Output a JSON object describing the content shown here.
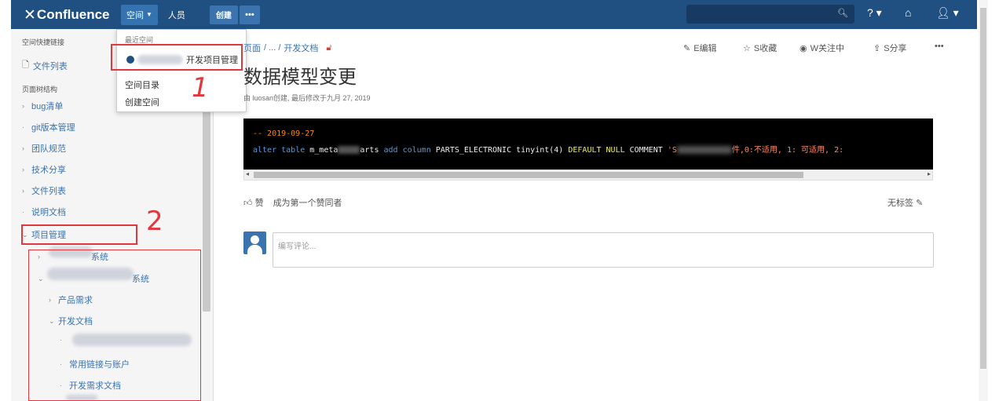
{
  "topnav": {
    "logo": "Confluence",
    "spaces": "空间",
    "people": "人员",
    "create": "创建",
    "more": "•••"
  },
  "sidebar": {
    "shortcuts_heading": "空间快捷链接",
    "file_list_link": "文件列表",
    "tree_heading": "页面树结构",
    "tree": [
      "bug清单",
      "git版本管理",
      "团队规范",
      "技术分享",
      "文件列表",
      "说明文档",
      "项目管理"
    ],
    "sub_tree": [
      "系统",
      "系统",
      "产品需求",
      "开发文档",
      "常用链接与账户",
      "开发需求文档"
    ]
  },
  "dropdown": {
    "recent": "最近空间",
    "project_space": "开发项目管理",
    "directory": "空间目录",
    "create_space": "创建空间"
  },
  "annotations": {
    "one": "1",
    "two": "2"
  },
  "page": {
    "breadcrumb_home": "页面",
    "breadcrumb_ellipsis": "/ ... /",
    "breadcrumb_parent": "开发文档",
    "title": "数据模型变更",
    "byline": "由 luosan创建, 最后修改于九月 27, 2019",
    "actions": {
      "edit": "E编辑",
      "save": "S收藏",
      "watch": "W关注中",
      "share": "S分享",
      "more": "•••"
    },
    "code": {
      "comment": "-- 2019-09-27",
      "line_kw1": "alter table",
      "line_table_a": "m_meta",
      "line_table_b": "arts",
      "line_kw2": "add column",
      "line_col": "PARTS_ELECTRONIC tinyint(4)",
      "line_default": "DEFAULT NULL",
      "line_comment": "COMMENT",
      "line_str_a": "'S",
      "line_str_b": "件,0:不适用, 1: 可适用, 2:"
    },
    "like_label": "赞",
    "like_first": "成为第一个赞同者",
    "no_labels": "无标签",
    "comment_placeholder": "编写评论..."
  },
  "colors": {
    "nav_bg": "#205081",
    "link": "#3b73af",
    "annotation": "#e0383c"
  }
}
